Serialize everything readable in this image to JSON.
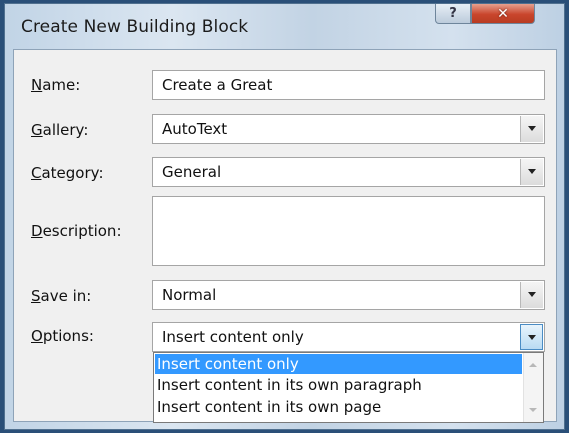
{
  "window": {
    "title": "Create New Building Block",
    "help_glyph": "?",
    "close_glyph": "✕"
  },
  "form": {
    "name_label_key": "N",
    "name_label_rest": "ame:",
    "name_value": "Create a Great",
    "gallery_label_key": "G",
    "gallery_label_rest": "allery:",
    "gallery_value": "AutoText",
    "category_label_key": "C",
    "category_label_rest": "ategory:",
    "category_value": "General",
    "description_label_key": "D",
    "description_label_rest": "escription:",
    "description_value": "",
    "savein_label_key": "S",
    "savein_label_rest": "ave in:",
    "savein_value": "Normal",
    "options_label_key": "O",
    "options_label_rest": "ptions:",
    "options_value": "Insert content only"
  },
  "options_dropdown": {
    "items": [
      "Insert content only",
      "Insert content in its own paragraph",
      "Insert content in its own page"
    ],
    "selected_index": 0
  }
}
